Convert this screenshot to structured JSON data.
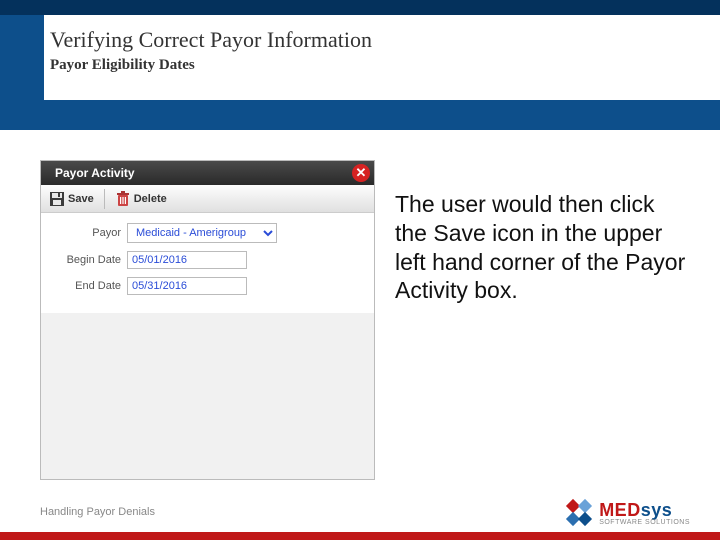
{
  "header": {
    "title": "Verifying Correct Payor Information",
    "subtitle": "Payor Eligibility Dates"
  },
  "panel": {
    "title": "Payor Activity",
    "toolbar": {
      "save_label": "Save",
      "delete_label": "Delete"
    },
    "fields": {
      "payor_label": "Payor",
      "payor_value": "Medicaid - Amerigroup",
      "begin_label": "Begin Date",
      "begin_value": "05/01/2016",
      "end_label": "End Date",
      "end_value": "05/31/2016"
    }
  },
  "instruction_text": "The user would then click the Save icon in the upper left hand corner of the Payor Activity box.",
  "footer": {
    "text": "Handling Payor Denials",
    "logo_main_1": "MED",
    "logo_main_2": "sys",
    "logo_sub": "SOFTWARE SOLUTIONS"
  },
  "colors": {
    "d1": "#c01818",
    "d2": "#0d4f8b",
    "d3": "#6aa2d8",
    "d4": "#2b6fb0"
  }
}
